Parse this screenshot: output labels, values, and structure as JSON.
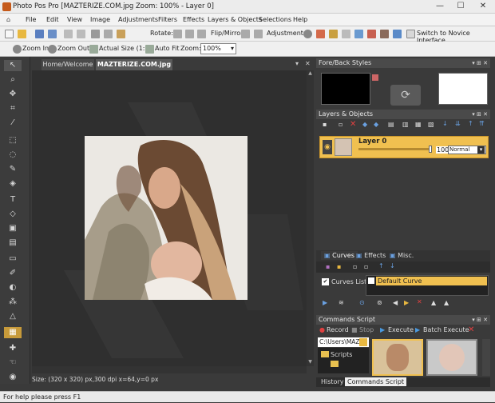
{
  "window": {
    "title": "Photo Pos Pro [MAZTERIZE.COM.jpg Zoom: 100% - Layer 0]",
    "minimize": "—",
    "maximize": "☐",
    "close": "✕"
  },
  "menu": [
    "File",
    "Edit",
    "View",
    "Image",
    "Adjustments",
    "Filters",
    "Effects",
    "Layers & Objects",
    "Selections",
    "Help"
  ],
  "toolbar1": {
    "rotate": "Rotate:",
    "flip_mirror": "Flip/Mirror",
    "adjustments": "Adjustments:",
    "novice": "Switch to Novice Interface"
  },
  "toolbar2": {
    "zoom_in": "Zoom In",
    "zoom_out": "Zoom Out",
    "actual_size": "Actual Size (1:1)",
    "auto_fit": "Auto Fit",
    "zoom_label": "Zoom:",
    "zoom_value": "100%"
  },
  "document": {
    "tabs": [
      "Home/Welcome",
      "MAZTERIZE.COM.jpg"
    ],
    "status": "Size: (320 x 320) px,300 dpi   x=64,y=0 px"
  },
  "panels": {
    "fore_back": {
      "title": "Fore/Back Styles",
      "fore_color": "#000000",
      "back_color": "#ffffff"
    },
    "layers": {
      "title": "Layers & Objects",
      "layer_name": "Layer 0",
      "opacity": "100",
      "blend": "Normal"
    },
    "curves": {
      "tabs": [
        "Curves",
        "Effects",
        "Misc."
      ],
      "list_label": "Curves List:",
      "curve_name": "Default Curve"
    },
    "commands": {
      "title": "Commands Script",
      "record": "Record",
      "stop": "Stop",
      "execute": "Execute",
      "batch": "Batch Execute",
      "path": "C:\\Users\\MAZ",
      "folder": "Scripts",
      "tabs": [
        "History",
        "Commands Script"
      ]
    }
  },
  "statusbar": "For help please press F1",
  "colors": {
    "accent": "#f0c050",
    "panel": "#3a3a3a",
    "header": "#4a4a4a"
  }
}
